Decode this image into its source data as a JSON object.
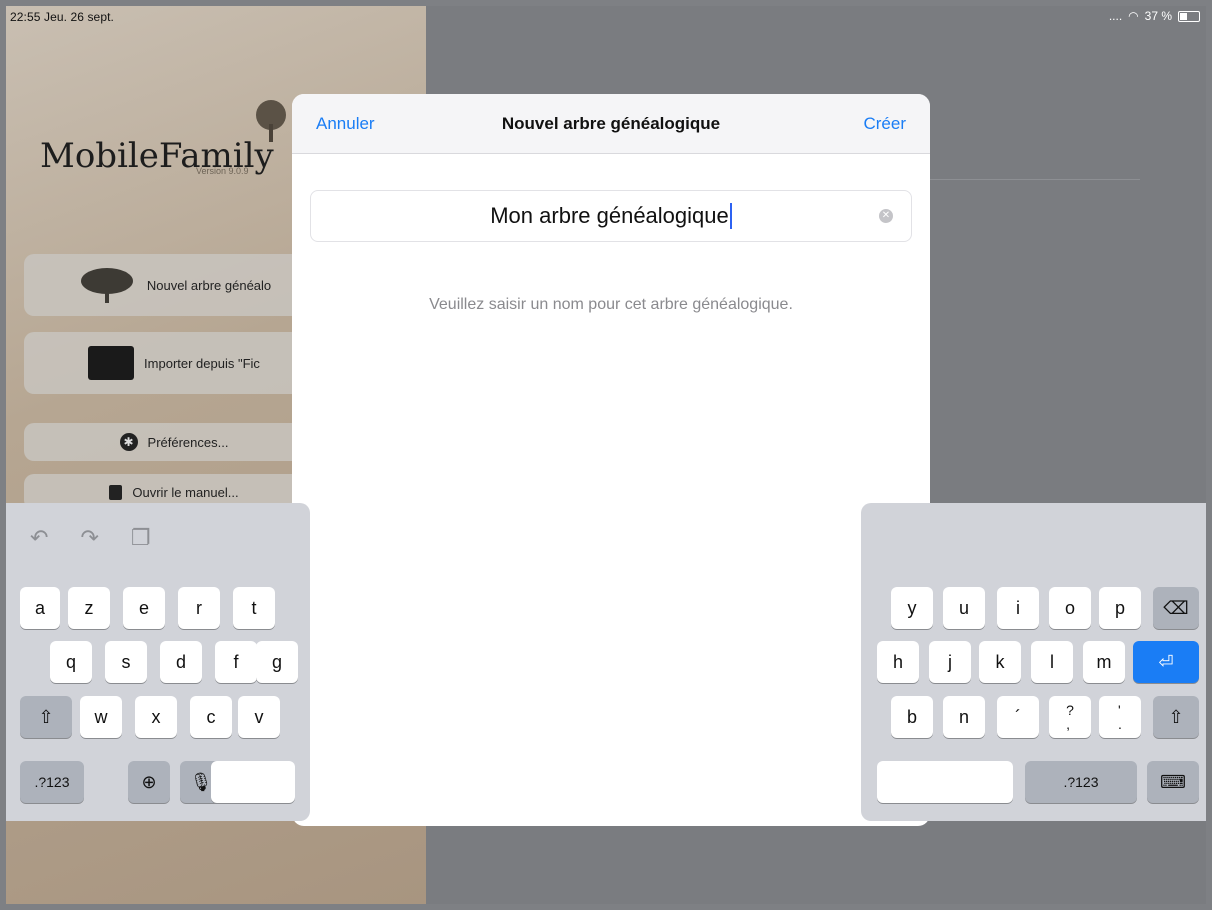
{
  "status": {
    "time": "22:55  Jeu. 26 sept.",
    "signal": "....",
    "battery": "37 %"
  },
  "app": {
    "logo": "MobileFamily",
    "version": "Version 9.0.9",
    "buttons": {
      "new_tree": "Nouvel arbre généalo",
      "import": "Importer depuis \"Fic",
      "preferences": "Préférences...",
      "manual": "Ouvrir le manuel..."
    }
  },
  "sheet": {
    "cancel": "Annuler",
    "title": "Nouvel arbre généalogique",
    "create": "Créer",
    "name_value": "Mon arbre généalogique",
    "hint": "Veuillez saisir un nom pour cet arbre généalogique."
  },
  "keyboard": {
    "left_row1": [
      "a",
      "z",
      "e",
      "r",
      "t"
    ],
    "left_row2": [
      "q",
      "s",
      "d",
      "f",
      "g"
    ],
    "left_row3": [
      "w",
      "x",
      "c",
      "v"
    ],
    "right_row1": [
      "y",
      "u",
      "i",
      "o",
      "p"
    ],
    "right_row2": [
      "h",
      "j",
      "k",
      "l",
      "m"
    ],
    "right_row3": [
      "b",
      "n",
      "´",
      "?\n,",
      "'\n."
    ],
    "numbers": ".?123",
    "return_icon": "return-icon"
  },
  "colors": {
    "accent": "#1a7df5"
  }
}
